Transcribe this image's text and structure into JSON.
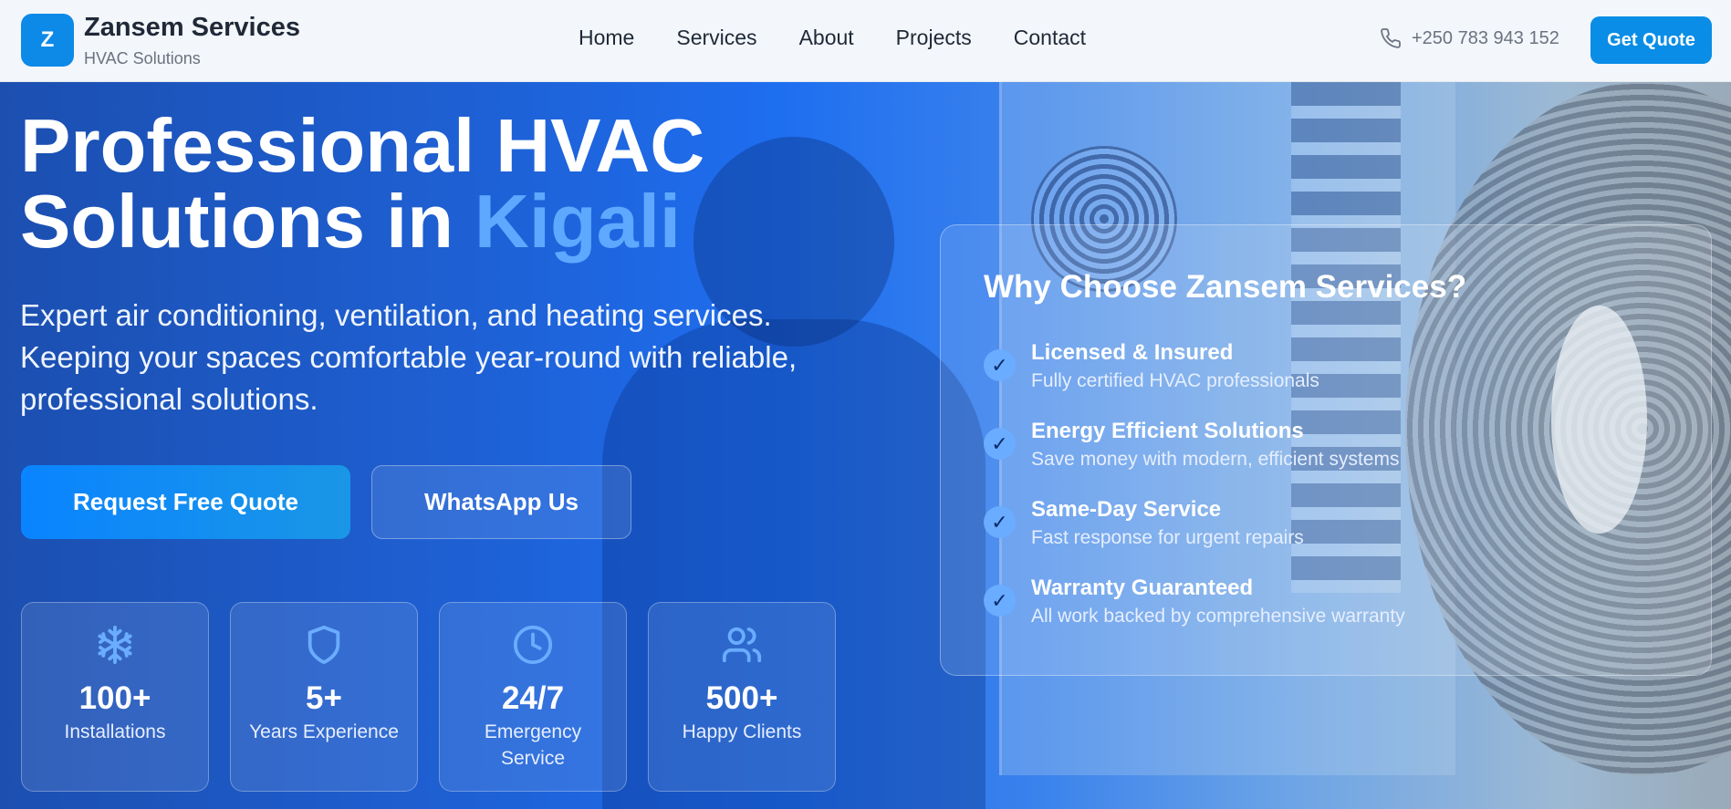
{
  "header": {
    "logo_letter": "Z",
    "brand_name": "Zansem Services",
    "brand_sub": "HVAC Solutions",
    "nav": [
      "Home",
      "Services",
      "About",
      "Projects",
      "Contact"
    ],
    "phone": "+250 783 943 152",
    "cta": "Get Quote"
  },
  "hero": {
    "title_line1": "Professional HVAC",
    "title_line2_prefix": "Solutions in ",
    "title_line2_accent": "Kigali",
    "subtitle": "Expert air conditioning, ventilation, and heating services. Keeping your spaces comfortable year-round with reliable, professional solutions.",
    "primary_button": "Request Free Quote",
    "secondary_button": "WhatsApp Us"
  },
  "stats": [
    {
      "icon": "snowflake-icon",
      "value": "100+",
      "label": "Installations"
    },
    {
      "icon": "shield-icon",
      "value": "5+",
      "label": "Years Experience"
    },
    {
      "icon": "clock-icon",
      "value": "24/7",
      "label": "Emergency Service"
    },
    {
      "icon": "users-icon",
      "value": "500+",
      "label": "Happy Clients"
    }
  ],
  "why": {
    "title": "Why Choose Zansem Services?",
    "items": [
      {
        "heading": "Licensed & Insured",
        "desc": "Fully certified HVAC professionals"
      },
      {
        "heading": "Energy Efficient Solutions",
        "desc": "Save money with modern, efficient systems"
      },
      {
        "heading": "Same-Day Service",
        "desc": "Fast response for urgent repairs"
      },
      {
        "heading": "Warranty Guaranteed",
        "desc": "All work backed by comprehensive warranty"
      }
    ]
  },
  "colors": {
    "brand": "#0d8ae8",
    "accent_text": "#5ea8ff",
    "check_bg": "#6aacff"
  }
}
